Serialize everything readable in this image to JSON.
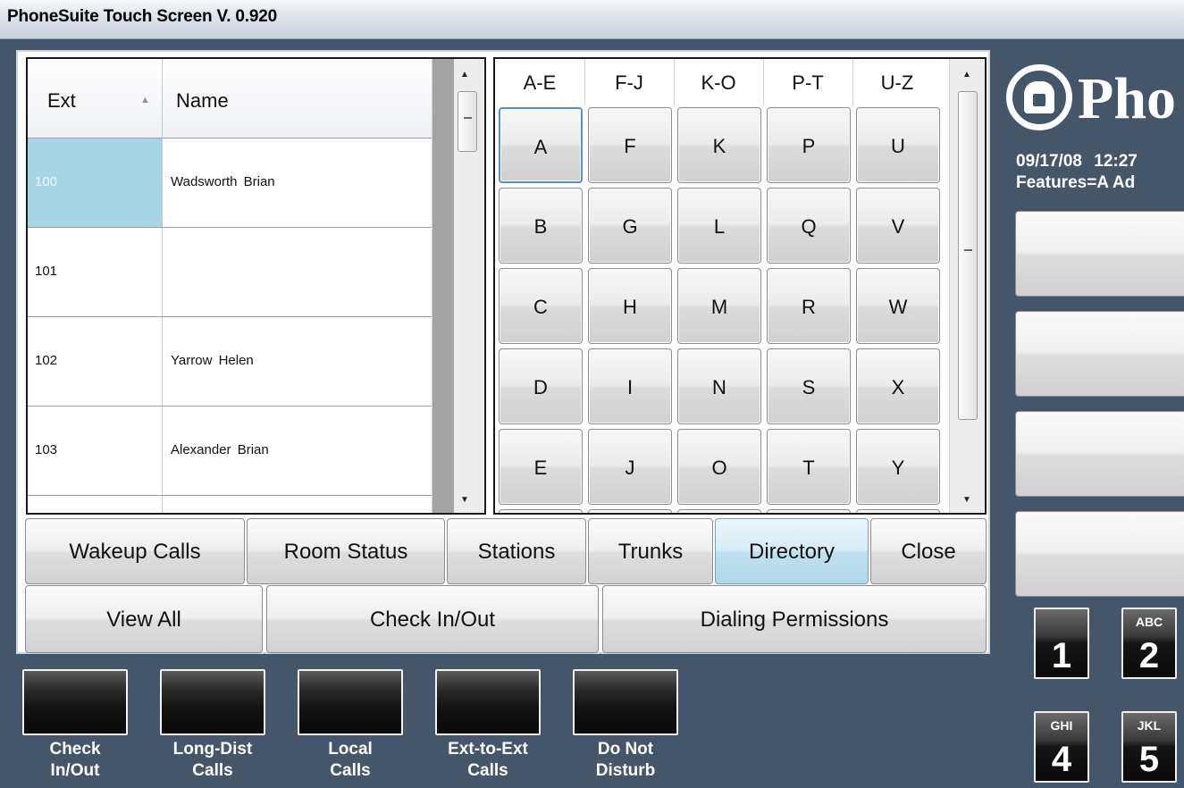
{
  "window": {
    "title": "PhoneSuite Touch Screen V. 0.920"
  },
  "directory": {
    "columns": {
      "ext": "Ext",
      "name": "Name"
    },
    "rows": [
      {
        "ext": "100",
        "name": "Wadsworth  Brian",
        "selected": true
      },
      {
        "ext": "101",
        "name": ""
      },
      {
        "ext": "102",
        "name": "Yarrow  Helen"
      },
      {
        "ext": "103",
        "name": "Alexander  Brian"
      },
      {
        "ext": "",
        "name": ""
      }
    ]
  },
  "alphabet": {
    "groups": [
      "A-E",
      "F-J",
      "K-O",
      "P-T",
      "U-Z"
    ],
    "columns": [
      [
        "A",
        "B",
        "C",
        "D",
        "E"
      ],
      [
        "F",
        "G",
        "H",
        "I",
        "J"
      ],
      [
        "K",
        "L",
        "M",
        "N",
        "O"
      ],
      [
        "P",
        "Q",
        "R",
        "S",
        "T"
      ],
      [
        "U",
        "V",
        "W",
        "X",
        "Y"
      ]
    ],
    "focused": "A"
  },
  "tabs": {
    "wakeup": "Wakeup Calls",
    "room_status": "Room Status",
    "stations": "Stations",
    "trunks": "Trunks",
    "directory": "Directory",
    "close": "Close",
    "active": "Directory"
  },
  "actions": {
    "view_all": "View All",
    "check_inout": "Check In/Out",
    "dialing_permissions": "Dialing Permissions"
  },
  "features": [
    {
      "line1": "Check",
      "line2": "In/Out"
    },
    {
      "line1": "Long-Dist",
      "line2": "Calls"
    },
    {
      "line1": "Local",
      "line2": "Calls"
    },
    {
      "line1": "Ext-to-Ext",
      "line2": "Calls"
    },
    {
      "line1": "Do Not",
      "line2": "Disturb"
    }
  ],
  "status": {
    "logo_text": "Pho",
    "date": "09/17/08",
    "time": "12:27",
    "features_text": "Features=A Ad"
  },
  "dialpad": [
    {
      "letters": "",
      "digit": "1"
    },
    {
      "letters": "ABC",
      "digit": "2"
    },
    {
      "letters": "GHI",
      "digit": "4"
    },
    {
      "letters": "JKL",
      "digit": "5"
    }
  ],
  "colors": {
    "background": "#44566a",
    "selected_cell": "#a9d6e6",
    "active_tab": "#bfe0ef"
  }
}
